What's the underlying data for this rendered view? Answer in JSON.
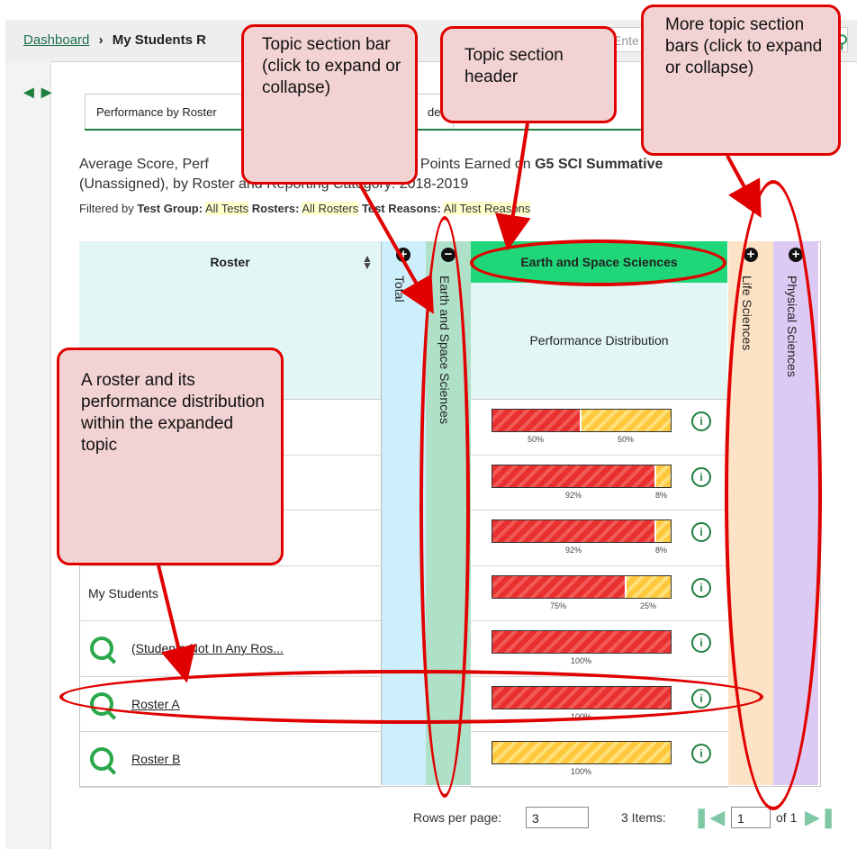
{
  "breadcrumb": {
    "link": "Dashboard",
    "separator": "›",
    "current": "My Students R"
  },
  "search": {
    "placeholder": "Ente"
  },
  "tab": {
    "label": "Performance by Roster",
    "label2": "den"
  },
  "caption": {
    "line1a": "Average Score, Perf",
    "line1b": "nd Average Points Earned on ",
    "line1c": "G5 SCI Summative",
    "line2": "(Unassigned), by Roster and Reporting Category: 2018-2019"
  },
  "filter": {
    "test_group_label": "Test Group:",
    "test_group": "All Tests",
    "rosters_label": "Rosters:",
    "rosters": "All Rosters",
    "reasons_label": "Test Reasons:",
    "reasons": "All Test Reasons",
    "prefix": "Filtered by"
  },
  "table": {
    "roster_header": "Roster",
    "col_total": "Total",
    "col_es": "Earth and Space Sciences",
    "col_life": "Life Sciences",
    "col_phys": "Physical Sciences",
    "es_header": "Earth and Space Sciences",
    "es_sub": "Performance Distribution",
    "rows": [
      {
        "label": "",
        "red": 50,
        "yellow": 50,
        "pct_red": "50%",
        "pct_yel": "50%"
      },
      {
        "label": "",
        "red": 92,
        "yellow": 8,
        "pct_red": "92%",
        "pct_yel": "8%"
      },
      {
        "label": "",
        "red": 92,
        "yellow": 8,
        "pct_red": "92%",
        "pct_yel": "8%"
      },
      {
        "label": "My Students",
        "red": 75,
        "yellow": 25,
        "pct_red": "75%",
        "pct_yel": "25%"
      },
      {
        "label": "(Students Not In Any Ros...",
        "red": 100,
        "yellow": 0,
        "pct_red": "100%",
        "pct_yel": ""
      },
      {
        "label": "Roster A",
        "red": 100,
        "yellow": 0,
        "pct_red": "100%",
        "pct_yel": ""
      },
      {
        "label": "Roster B",
        "red": 0,
        "yellow": 100,
        "pct_red": "",
        "pct_yel": "100%"
      }
    ]
  },
  "pager": {
    "rows_label": "Rows per page:",
    "rows_value": "3",
    "items": "3 Items:",
    "page": "1",
    "of": "of 1"
  },
  "callouts": {
    "topic_bar": "Topic section bar (click to expand or collapse)",
    "topic_header": "Topic section header",
    "more_bars": "More topic section bars (click to expand or collapse)",
    "roster": "A roster and its performance distribution within the expanded topic"
  },
  "colors": {
    "accent": "#1d7f3e",
    "callout_border": "#e00000",
    "callout_fill": "#f2d2d2",
    "es_header": "#1fd679"
  }
}
